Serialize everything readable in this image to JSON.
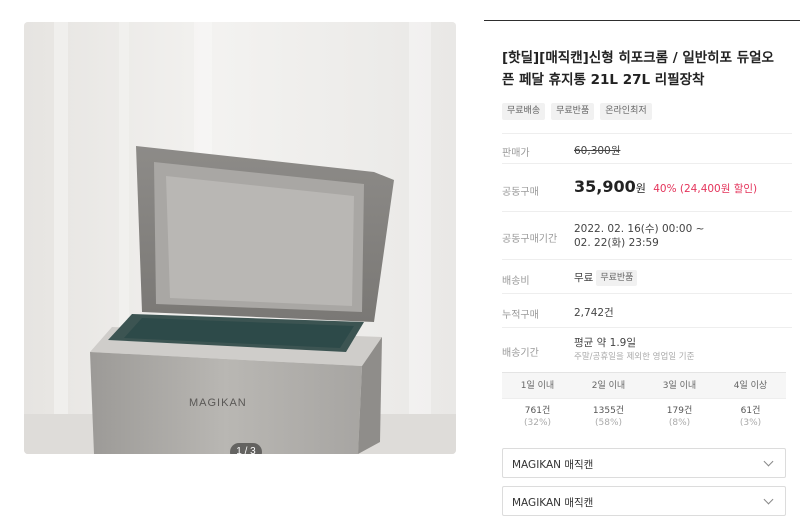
{
  "gallery": {
    "counter": "1 / 3",
    "brand_print": "MAGIKAN"
  },
  "product": {
    "title": "[핫딜][매직캔]신형 히포크롬 / 일반히포 듀얼오픈 페달 휴지통 21L 27L 리필장착",
    "tags": [
      "무료배송",
      "무료반품",
      "온라인최저"
    ]
  },
  "pricing": {
    "sale_label": "판매가",
    "original_price": "60,300원",
    "group_label": "공동구매",
    "group_price_number": "35,900",
    "group_price_unit": "원",
    "discount": "40% (24,400원 할인)"
  },
  "period": {
    "label": "공동구매기간",
    "line1": "2022. 02. 16(수) 00:00 ~",
    "line2": "02. 22(화) 23:59"
  },
  "shipping": {
    "label": "배송비",
    "value": "무료",
    "badge": "무료반품"
  },
  "cumulative": {
    "label": "누적구매",
    "value": "2,742건"
  },
  "delivery": {
    "label": "배송기간",
    "average": "평균 약 1.9일",
    "note": "주말/공휴일을 제외한 영업일 기준",
    "columns": [
      {
        "head": "1일 이내",
        "count": "761건",
        "pct": "(32%)"
      },
      {
        "head": "2일 이내",
        "count": "1355건",
        "pct": "(58%)"
      },
      {
        "head": "3일 이내",
        "count": "179건",
        "pct": "(8%)"
      },
      {
        "head": "4일 이상",
        "count": "61건",
        "pct": "(3%)"
      }
    ]
  },
  "options": [
    {
      "selected": "MAGIKAN 매직캔"
    },
    {
      "selected": "MAGIKAN 매직캔"
    }
  ]
}
